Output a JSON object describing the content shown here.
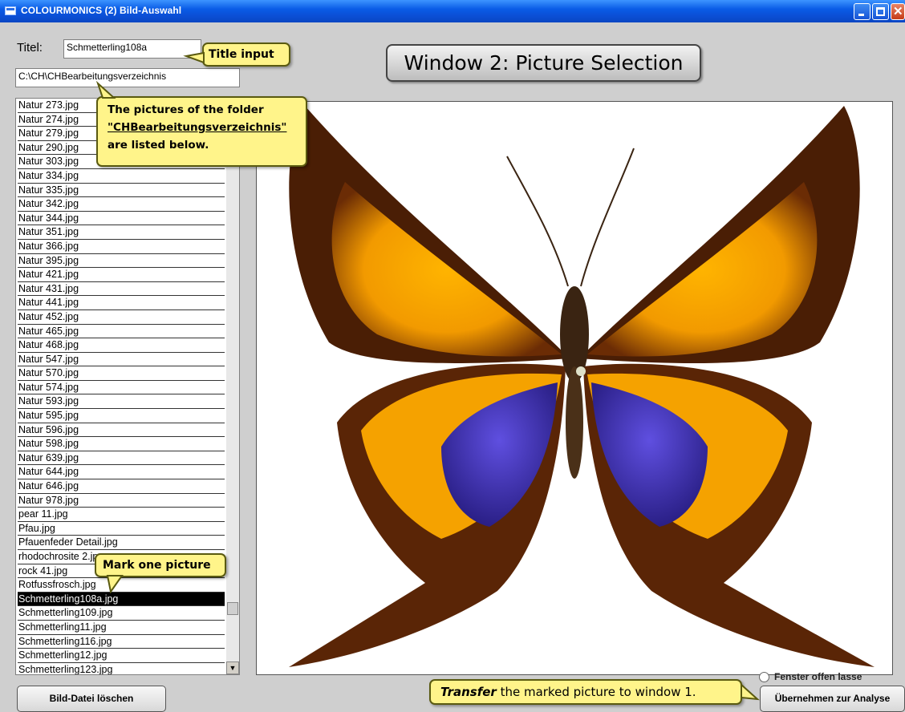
{
  "window": {
    "title": "COLOURMONICS (2) Bild-Auswahl"
  },
  "form": {
    "title_label": "Titel:",
    "title_value": "Schmetterling108a",
    "path_value": "C:\\CH\\CHBearbeitungsverzeichnis"
  },
  "heading": "Window 2: Picture Selection",
  "callouts": {
    "title_input": "Title input",
    "folder_line1": "The pictures of the folder",
    "folder_line2": "\"CHBearbeitungsverzeichnis\"",
    "folder_line3": "are listed below.",
    "mark": "Mark one picture",
    "transfer_bold": "Transfer",
    "transfer_rest": " the marked picture to window 1."
  },
  "files": [
    "Natur 273.jpg",
    "Natur 274.jpg",
    "Natur 279.jpg",
    "Natur 290.jpg",
    "Natur 303.jpg",
    "Natur 334.jpg",
    "Natur 335.jpg",
    "Natur 342.jpg",
    "Natur 344.jpg",
    "Natur 351.jpg",
    "Natur 366.jpg",
    "Natur 395.jpg",
    "Natur 421.jpg",
    "Natur 431.jpg",
    "Natur 441.jpg",
    "Natur 452.jpg",
    "Natur 465.jpg",
    "Natur 468.jpg",
    "Natur 547.jpg",
    "Natur 570.jpg",
    "Natur 574.jpg",
    "Natur 593.jpg",
    "Natur 595.jpg",
    "Natur 596.jpg",
    "Natur 598.jpg",
    "Natur 639.jpg",
    "Natur 644.jpg",
    "Natur 646.jpg",
    "Natur 978.jpg",
    "pear 11.jpg",
    "Pfau.jpg",
    "Pfauenfeder Detail.jpg",
    "rhodochrosite 2.jpg",
    "rock 41.jpg",
    "Rotfussfrosch.jpg",
    "Schmetterling108a.jpg",
    "Schmetterling109.jpg",
    "Schmetterling11.jpg",
    "Schmetterling116.jpg",
    "Schmetterling12.jpg",
    "Schmetterling123.jpg"
  ],
  "selected_file": "Schmetterling108a.jpg",
  "buttons": {
    "delete": "Bild-Datei löschen",
    "apply": "Übernehmen zur Analyse"
  },
  "radio_label": "Fenster offen lasse",
  "colors": {
    "titlebar": "#0a5ce6",
    "callout": "#fff48a",
    "selection": "#000000"
  }
}
